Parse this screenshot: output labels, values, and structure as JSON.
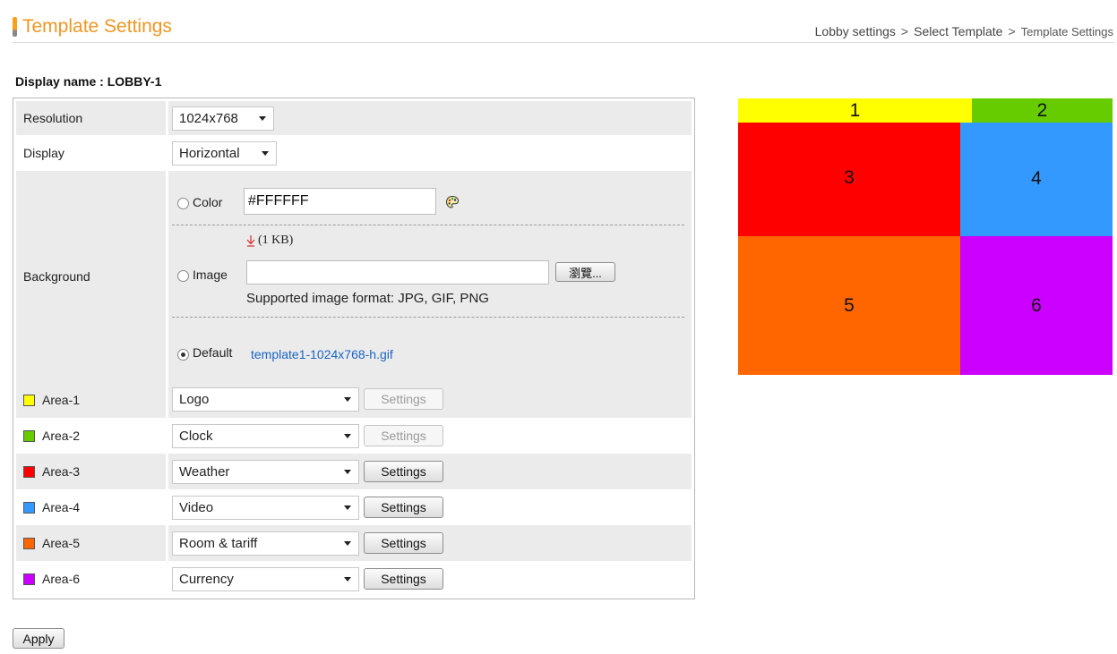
{
  "header": {
    "title": "Template Settings",
    "breadcrumb": [
      "Lobby settings",
      "Select Template",
      "Template Settings"
    ],
    "breadcrumb_sep": ">"
  },
  "display_name": "Display name :  LOBBY-1",
  "form": {
    "resolution": {
      "label": "Resolution",
      "value": "1024x768"
    },
    "display": {
      "label": "Display",
      "value": "Horizontal"
    },
    "background": {
      "label": "Background",
      "color_option": "Color",
      "color_value": "#FFFFFF",
      "image_option": "Image",
      "image_size": "(1 KB)",
      "image_value": "",
      "browse_label": "瀏覽...",
      "supported_formats": "Supported image format: JPG, GIF, PNG",
      "default_option": "Default",
      "default_file": "template1-1024x768-h.gif",
      "selected": "Default"
    },
    "areas": [
      {
        "label": "Area-1",
        "color": "#ffff00",
        "content": "Logo",
        "settings_label": "Settings",
        "settings_enabled": false
      },
      {
        "label": "Area-2",
        "color": "#66cc00",
        "content": "Clock",
        "settings_label": "Settings",
        "settings_enabled": false
      },
      {
        "label": "Area-3",
        "color": "#ff0000",
        "content": "Weather",
        "settings_label": "Settings",
        "settings_enabled": true
      },
      {
        "label": "Area-4",
        "color": "#3399ff",
        "content": "Video",
        "settings_label": "Settings",
        "settings_enabled": true
      },
      {
        "label": "Area-5",
        "color": "#ff6600",
        "content": "Room & tariff",
        "settings_label": "Settings",
        "settings_enabled": true
      },
      {
        "label": "Area-6",
        "color": "#cc00ff",
        "content": "Currency",
        "settings_label": "Settings",
        "settings_enabled": true
      }
    ]
  },
  "preview": {
    "cells": [
      {
        "label": "1",
        "color": "#ffff00"
      },
      {
        "label": "2",
        "color": "#66cc00"
      },
      {
        "label": "3",
        "color": "#ff0000"
      },
      {
        "label": "4",
        "color": "#3399ff"
      },
      {
        "label": "5",
        "color": "#ff6600"
      },
      {
        "label": "6",
        "color": "#cc00ff"
      }
    ]
  },
  "apply_label": "Apply",
  "colors": {
    "accent": "#f19622",
    "link": "#1a64c4",
    "row_shade": "#ebebeb"
  }
}
